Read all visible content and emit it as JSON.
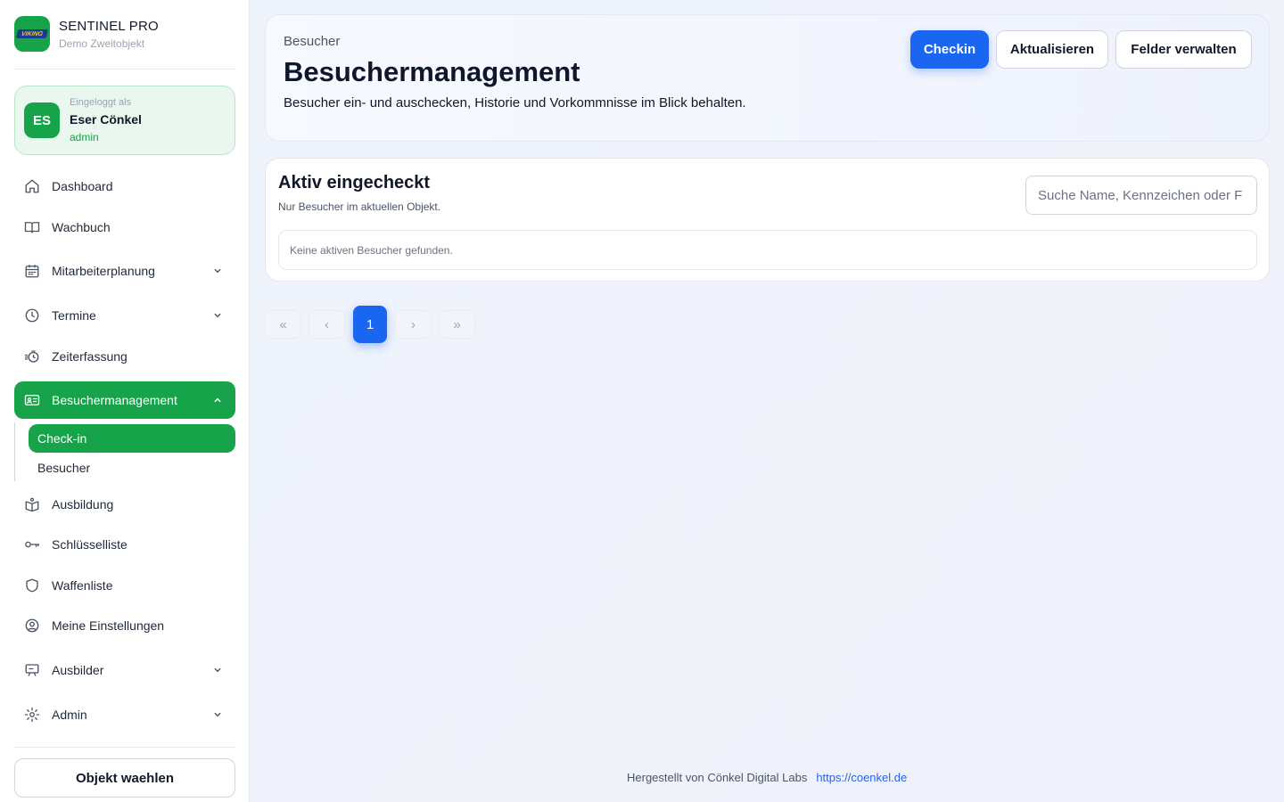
{
  "brand": {
    "title": "SENTINEL PRO",
    "subtitle": "Demo Zweitobjekt",
    "logo_text": "VIKING"
  },
  "user": {
    "caption": "Eingeloggt als",
    "initials": "ES",
    "name": "Eser Cönkel",
    "role": "admin"
  },
  "nav": {
    "dashboard": "Dashboard",
    "wachbuch": "Wachbuch",
    "mitarbeiterplanung": "Mitarbeiterplanung",
    "termine": "Termine",
    "zeiterfassung": "Zeiterfassung",
    "besuchermanagement": "Besuchermanagement",
    "sub_checkin": "Check-in",
    "sub_besucher": "Besucher",
    "ausbildung": "Ausbildung",
    "schluesselliste": "Schlüsselliste",
    "waffenliste": "Waffenliste",
    "einstellungen": "Meine Einstellungen",
    "ausbilder": "Ausbilder",
    "admin": "Admin"
  },
  "object_button": "Objekt waehlen",
  "header": {
    "breadcrumb": "Besucher",
    "title": "Besuchermanagement",
    "description": "Besucher ein- und auschecken, Historie und Vorkommnisse im Blick behalten.",
    "btn_checkin": "Checkin",
    "btn_refresh": "Aktualisieren",
    "btn_fields": "Felder verwalten"
  },
  "active_list": {
    "title": "Aktiv eingecheckt",
    "subtitle": "Nur Besucher im aktuellen Objekt.",
    "search_placeholder": "Suche Name, Kennzeichen oder F",
    "empty_text": "Keine aktiven Besucher gefunden."
  },
  "pagination": {
    "first": "«",
    "prev": "‹",
    "current": "1",
    "next": "›",
    "last": "»"
  },
  "footer": {
    "made_by": "Hergestellt von Cönkel Digital Labs",
    "link": "https://coenkel.de"
  },
  "colors": {
    "accent_green": "#16a34a",
    "primary_blue": "#1a66f0"
  }
}
